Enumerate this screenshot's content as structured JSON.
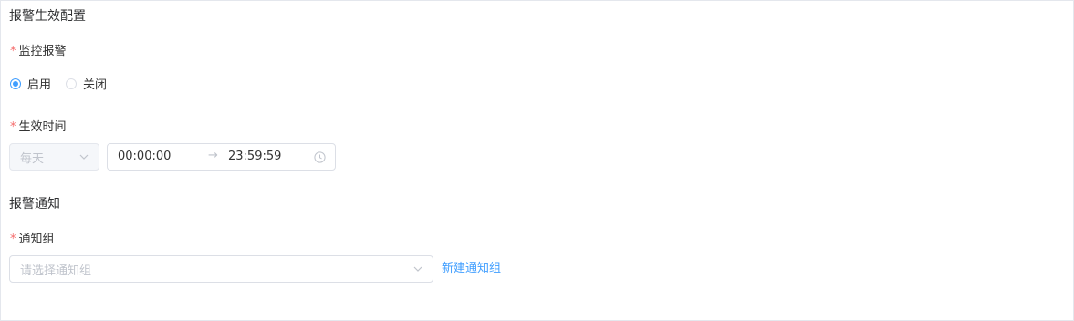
{
  "effective_config": {
    "title": "报警生效配置",
    "monitor_alarm": {
      "required_mark": "*",
      "label": "监控报警",
      "options": [
        {
          "label": "启用",
          "checked": true
        },
        {
          "label": "关闭",
          "checked": false
        }
      ]
    },
    "effective_time": {
      "required_mark": "*",
      "label": "生效时间",
      "period_select": {
        "value": "每天",
        "disabled": true,
        "icon": "chevron-down-icon"
      },
      "time_range": {
        "start": "00:00:00",
        "separator": "→",
        "end": "23:59:59",
        "icon": "clock-icon"
      }
    }
  },
  "notification": {
    "title": "报警通知",
    "group": {
      "required_mark": "*",
      "label": "通知组",
      "placeholder": "请选择通知组",
      "icon": "chevron-down-icon",
      "create_link": "新建通知组"
    }
  },
  "colors": {
    "accent": "#409eff",
    "required": "#f56c6c",
    "border": "#dcdfe6",
    "placeholder": "#c0c4cc"
  }
}
